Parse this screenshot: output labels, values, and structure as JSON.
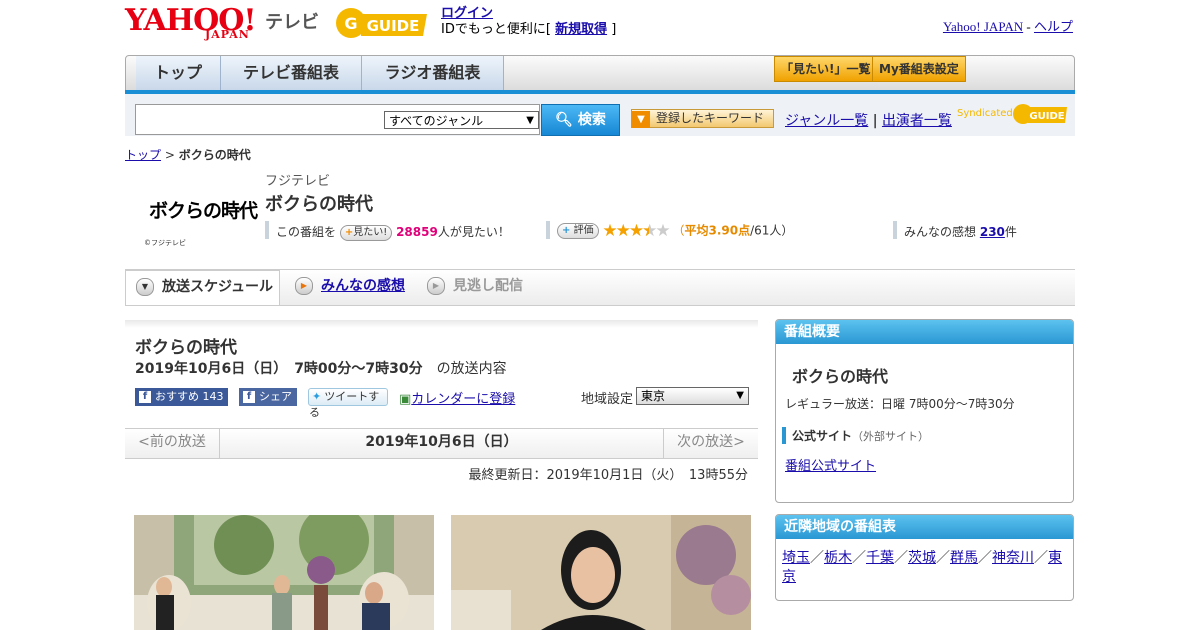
{
  "header": {
    "yahoo_logo": "YAHOO!",
    "japan_logo": "JAPAN",
    "tv_label": "テレビ",
    "gguide_logo": "GUIDE",
    "login_link": "ログイン",
    "login_prefix": "IDでもっと便利に[",
    "register_link": "新規取得",
    "login_suffix": "]",
    "yahoo_japan_link": "Yahoo! JAPAN",
    "separator": "-",
    "help_link": "ヘルプ"
  },
  "nav": {
    "tabs": [
      "トップ",
      "テレビ番組表",
      "ラジオ番組表"
    ],
    "mitai_list": "「見たい!」一覧",
    "my_schedule": "My番組表設定"
  },
  "search": {
    "genre_select": "すべてのジャンル",
    "search_button": "検索",
    "keyword_button": "登録したキーワード",
    "genre_list_link": "ジャンル一覧",
    "divider": "|",
    "performer_list_link": "出演者一覧",
    "syndicated": "Syndicated",
    "syndicated_logo": "GUIDE"
  },
  "breadcrumb": {
    "top": "トップ",
    "sep": ">",
    "current": "ボクらの時代"
  },
  "program": {
    "logo_text": "ボクらの時代",
    "logo_copyright": "©フジテレビ",
    "station": "フジテレビ",
    "title": "ボクらの時代",
    "mitai_prefix": "この番組を",
    "mitai_button": "見たい!",
    "mitai_count": "28859",
    "mitai_suffix": "人が見たい！",
    "rate_button": "評価",
    "rating": 3.9,
    "rating_open": "（",
    "rating_avg": "平均3.90点",
    "rating_count": "/61人）",
    "kansou_label": "みんなの感想",
    "kansou_count": "230",
    "kansou_unit": "件"
  },
  "tabs": {
    "schedule": "放送スケジュール",
    "kansou": "みんなの感想",
    "missed": "見逃し配信"
  },
  "content": {
    "title": "ボクらの時代",
    "date_time": "2019年10月6日（日）　7時00分～7時30分",
    "date_suffix": "の放送内容",
    "fb_recommend": "おすすめ",
    "fb_count": "143",
    "fb_share": "シェア",
    "tweet": "ツイートする",
    "calendar": "カレンダーに登録",
    "region_label": "地域設定",
    "region_value": "東京",
    "prev": "<前の放送",
    "current_date": "2019年10月6日（日）",
    "next": "次の放送>",
    "last_updated": "最終更新日：2019年10月1日（火）　13時55分"
  },
  "sidebar": {
    "overview_heading": "番組概要",
    "overview_title": "ボクらの時代",
    "regular": "レギュラー放送：日曜 7時00分～7時30分",
    "official_label": "公式サイト",
    "official_note": "（外部サイト）",
    "official_link": "番組公式サイト",
    "nearby_heading": "近隣地域の番組表",
    "nearby": [
      "埼玉",
      "栃木",
      "千葉",
      "茨城",
      "群馬",
      "神奈川",
      "東京"
    ],
    "nearby_sep": "／"
  }
}
